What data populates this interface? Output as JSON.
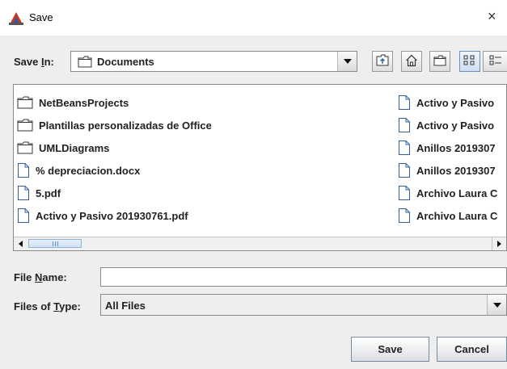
{
  "window": {
    "title": "Save",
    "close_glyph": "×"
  },
  "save_in": {
    "label_pre": "Save ",
    "label_mnemonic": "I",
    "label_post": "n:",
    "value": "Documents"
  },
  "toolbar": {
    "icons": [
      "up-one-level-icon",
      "home-icon",
      "new-folder-icon",
      "list-view-icon",
      "details-view-icon"
    ]
  },
  "files": {
    "left": [
      {
        "name": "NetBeansProjects",
        "kind": "folder"
      },
      {
        "name": "Plantillas personalizadas de Office",
        "kind": "folder"
      },
      {
        "name": "UMLDiagrams",
        "kind": "folder"
      },
      {
        "name": "% depreciacion.docx",
        "kind": "file"
      },
      {
        "name": "5.pdf",
        "kind": "file"
      },
      {
        "name": "Activo y Pasivo 201930761.pdf",
        "kind": "file"
      }
    ],
    "right": [
      {
        "name": "Activo y Pasivo",
        "kind": "file"
      },
      {
        "name": "Activo y Pasivo",
        "kind": "file"
      },
      {
        "name": "Anillos 2019307",
        "kind": "file"
      },
      {
        "name": "Anillos 2019307",
        "kind": "file"
      },
      {
        "name": "Archivo Laura C",
        "kind": "file"
      },
      {
        "name": "Archivo Laura C",
        "kind": "file"
      }
    ]
  },
  "file_name": {
    "label_pre": "File ",
    "label_mnemonic": "N",
    "label_post": "ame:",
    "value": ""
  },
  "file_type": {
    "label_pre": "Files of ",
    "label_mnemonic": "T",
    "label_post": "ype:",
    "value": "All Files"
  },
  "buttons": {
    "save": "Save",
    "cancel": "Cancel"
  }
}
